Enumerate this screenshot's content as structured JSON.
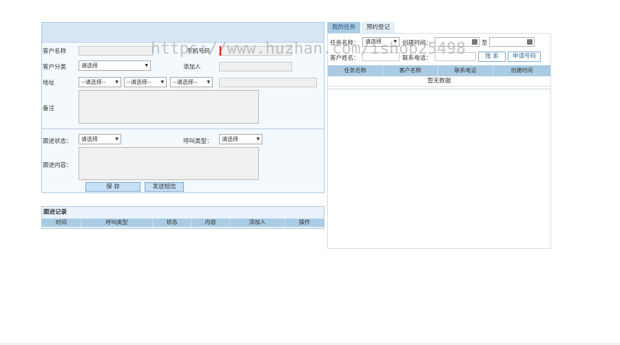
{
  "form": {
    "customer_name_label": "客户名称",
    "customer_phone_label": "手机号码",
    "customer_category_label": "客户分类",
    "customer_category_value": "请选择",
    "added_by_label": "添加人",
    "address_label": "地址",
    "province_value": "--请选择--",
    "city_value": "--请选择--",
    "district_value": "--请选择--",
    "remark_label": "备注",
    "follow_status_label": "跟进状态：",
    "follow_status_value": "请选择",
    "call_type_label": "呼叫类型：",
    "call_type_value": "请选择",
    "follow_content_label": "跟进内容：",
    "save_label": "保 存",
    "send_sms_label": "发送短信"
  },
  "records": {
    "title": "跟进记录",
    "columns": [
      "时间",
      "呼叫类型",
      "状态",
      "内容",
      "添加人",
      "操作"
    ]
  },
  "tasks": {
    "tabs": [
      "我的任务",
      "预约登记"
    ],
    "task_name_label": "任务名称：",
    "task_name_value": "请选择",
    "created_time_label": "创建时间：",
    "to_label": "至",
    "customer_name_label": "客户姓名：",
    "contact_phone_label": "联系电话：",
    "search_label": "搜 索",
    "dial_label": "申请号码",
    "columns": [
      "任务名称",
      "客户名称",
      "联系电话",
      "创建时间"
    ],
    "empty_text": "暂无数据"
  },
  "watermark": "https://www.huzhan.com/ishop25498",
  "colors": {
    "header_bg": "#d6e6f5",
    "table_header_bg": "#a9cbe3",
    "button_bg": "#c6e0f6"
  }
}
